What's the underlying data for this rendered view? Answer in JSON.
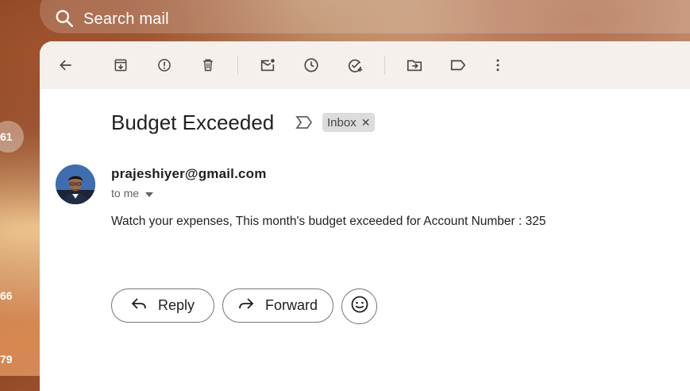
{
  "search": {
    "placeholder": "Search mail"
  },
  "side_counts": [
    "61",
    "66",
    "79"
  ],
  "email": {
    "subject": "Budget Exceeded",
    "label": "Inbox",
    "sender": "prajeshiyer@gmail.com",
    "recipient": "to me",
    "body": "Watch your expenses, This month's budget exceeded for Account Number : 325"
  },
  "actions": {
    "reply": "Reply",
    "forward": "Forward"
  },
  "colors": {
    "panel": "#ffffff",
    "chip": "#dcdcdc",
    "text": "#202124",
    "icon": "#444746"
  }
}
